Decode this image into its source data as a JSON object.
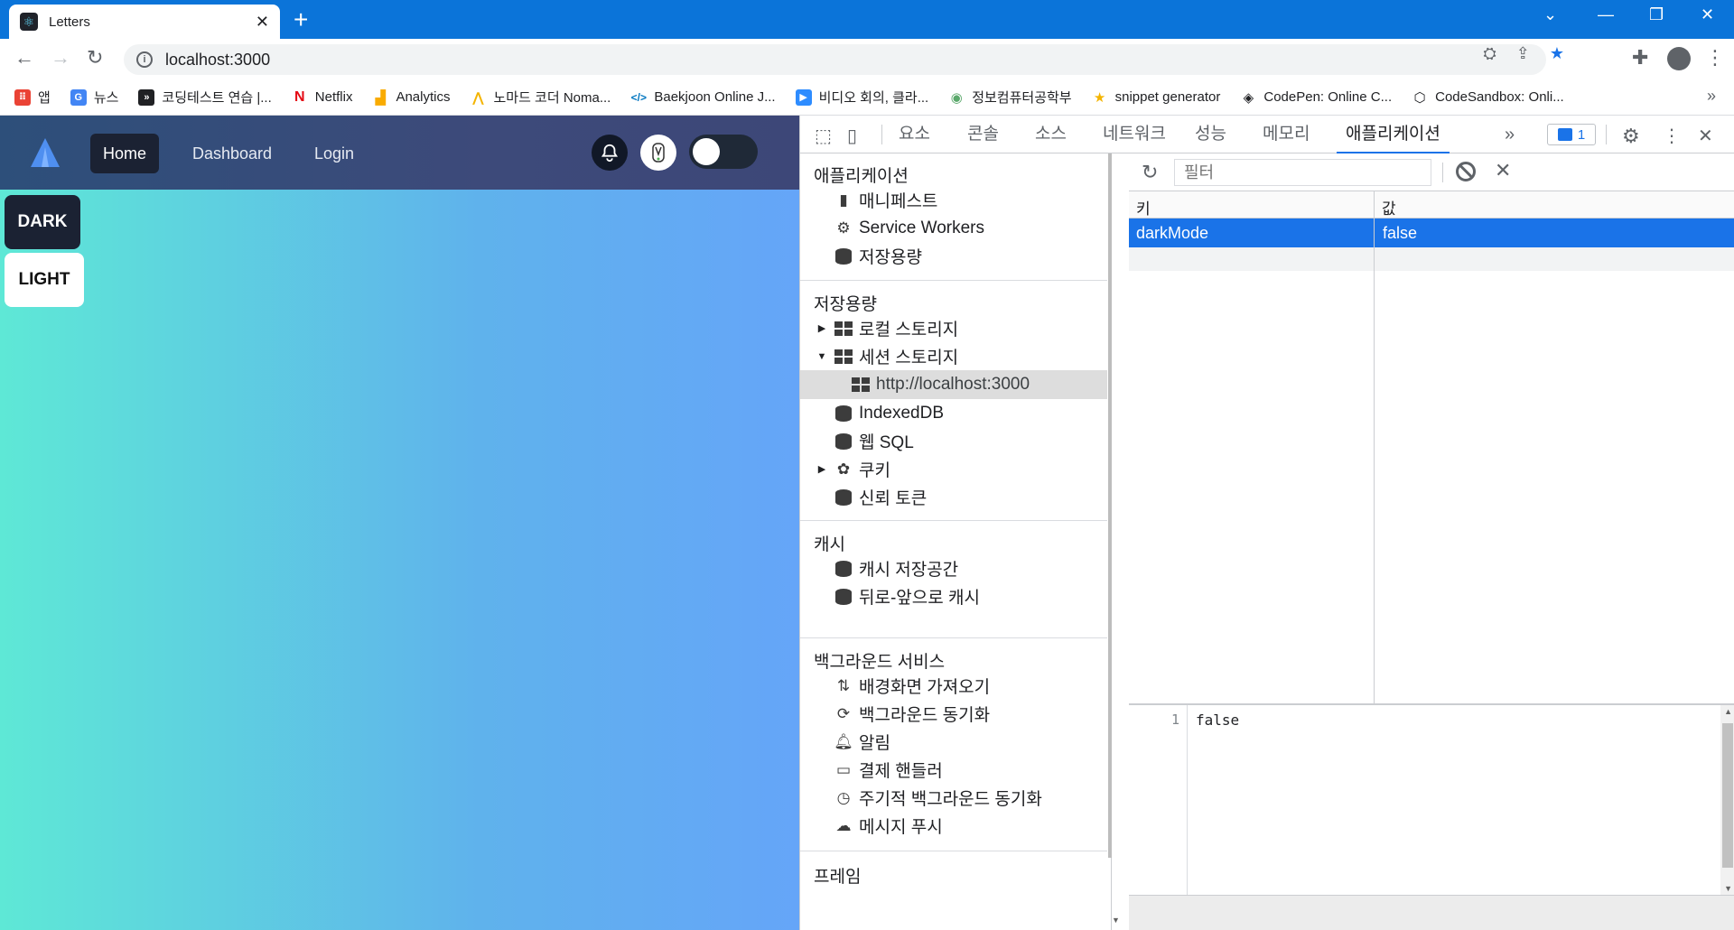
{
  "browser": {
    "tab_title": "Letters",
    "url": "localhost:3000",
    "bookmarks": [
      {
        "label": "앱",
        "icon": "apps-grid-icon",
        "color": "#ea4335"
      },
      {
        "label": "뉴스",
        "icon": "news-icon",
        "color": "#4285f4"
      },
      {
        "label": "코딩테스트 연습 |...",
        "icon": "programmers-icon",
        "color": "#202124"
      },
      {
        "label": "Netflix",
        "icon": "netflix-icon",
        "color": "#e50914"
      },
      {
        "label": "Analytics",
        "icon": "analytics-icon",
        "color": "#f9ab00"
      },
      {
        "label": "노마드 코더 Noma...",
        "icon": "nomad-icon",
        "color": "#f4b400"
      },
      {
        "label": "Baekjoon Online J...",
        "icon": "baekjoon-icon",
        "color": "#0076c0"
      },
      {
        "label": "비디오 회의, 클라...",
        "icon": "zoom-icon",
        "color": "#2d8cff"
      },
      {
        "label": "정보컴퓨터공학부",
        "icon": "university-icon",
        "color": "#5aa86b"
      },
      {
        "label": "snippet generator",
        "icon": "snippet-icon",
        "color": "#f4b400"
      },
      {
        "label": "CodePen: Online C...",
        "icon": "codepen-icon",
        "color": "#202124"
      },
      {
        "label": "CodeSandbox: Onli...",
        "icon": "codesandbox-icon",
        "color": "#202124"
      }
    ]
  },
  "app": {
    "nav": {
      "home": "Home",
      "dashboard": "Dashboard",
      "login": "Login"
    },
    "theme_dark": "DARK",
    "theme_light": "LIGHT"
  },
  "devtools": {
    "tabs": [
      "요소",
      "콘솔",
      "소스",
      "네트워크",
      "성능",
      "메모리",
      "애플리케이션"
    ],
    "issues_count": "1",
    "sidebar": {
      "application_title": "애플리케이션",
      "manifest": "매니페스트",
      "service_workers": "Service Workers",
      "storage_item": "저장용량",
      "storage_title": "저장용량",
      "local_storage": "로컬 스토리지",
      "session_storage": "세션 스토리지",
      "session_origin": "http://localhost:3000",
      "indexeddb": "IndexedDB",
      "websql": "웹 SQL",
      "cookies": "쿠키",
      "trust_tokens": "신뢰 토큰",
      "cache_title": "캐시",
      "cache_storage": "캐시 저장공간",
      "bfcache": "뒤로-앞으로 캐시",
      "bg_title": "백그라운드 서비스",
      "bg_fetch": "배경화면 가져오기",
      "bg_sync": "백그라운드 동기화",
      "notifications": "알림",
      "payment": "결제 핸들러",
      "periodic_sync": "주기적 백그라운드 동기화",
      "push": "메시지 푸시",
      "frames_title": "프레임"
    },
    "filter_placeholder": "필터",
    "table": {
      "key_header": "키",
      "value_header": "값",
      "rows": [
        {
          "key": "darkMode",
          "value": "false"
        }
      ]
    },
    "preview": {
      "line_no": "1",
      "content": "false"
    }
  }
}
